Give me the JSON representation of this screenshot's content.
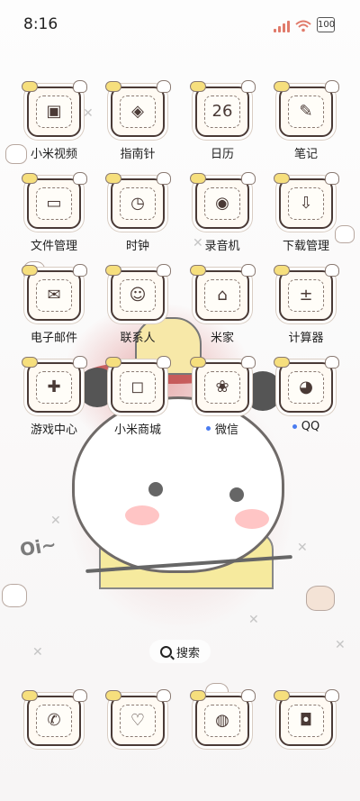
{
  "status_bar": {
    "time": "8:16",
    "battery": "100"
  },
  "apps": [
    {
      "label": "小米视频",
      "icon": "video-icon",
      "glyph": "▣"
    },
    {
      "label": "指南针",
      "icon": "compass-icon",
      "glyph": "◈"
    },
    {
      "label": "日历",
      "icon": "calendar-icon",
      "glyph": "26"
    },
    {
      "label": "笔记",
      "icon": "notes-icon",
      "glyph": "✎"
    },
    {
      "label": "文件管理",
      "icon": "folder-icon",
      "glyph": "▭"
    },
    {
      "label": "时钟",
      "icon": "clock-icon",
      "glyph": "◷"
    },
    {
      "label": "录音机",
      "icon": "recorder-icon",
      "glyph": "◉"
    },
    {
      "label": "下载管理",
      "icon": "download-icon",
      "glyph": "⇩"
    },
    {
      "label": "电子邮件",
      "icon": "mail-icon",
      "glyph": "✉"
    },
    {
      "label": "联系人",
      "icon": "contacts-icon",
      "glyph": "☺"
    },
    {
      "label": "米家",
      "icon": "mijia-icon",
      "glyph": "⌂"
    },
    {
      "label": "计算器",
      "icon": "calculator-icon",
      "glyph": "±"
    },
    {
      "label": "游戏中心",
      "icon": "gamepad-icon",
      "glyph": "✚"
    },
    {
      "label": "小米商城",
      "icon": "store-icon",
      "glyph": "◻"
    },
    {
      "label": "微信",
      "icon": "wechat-icon",
      "glyph": "❀",
      "badge": true
    },
    {
      "label": "QQ",
      "icon": "qq-icon",
      "glyph": "◕",
      "badge": true
    }
  ],
  "search": {
    "label": "搜索"
  },
  "dock": [
    {
      "icon": "phone-icon",
      "glyph": "✆"
    },
    {
      "icon": "messages-icon",
      "glyph": "♡"
    },
    {
      "icon": "browser-icon",
      "glyph": "◍"
    },
    {
      "icon": "camera-icon",
      "glyph": "◘"
    }
  ],
  "wallpaper_text": "Oi~",
  "colors": {
    "badge_dot": "#4a7cf0",
    "signal": "#e07a6a"
  }
}
